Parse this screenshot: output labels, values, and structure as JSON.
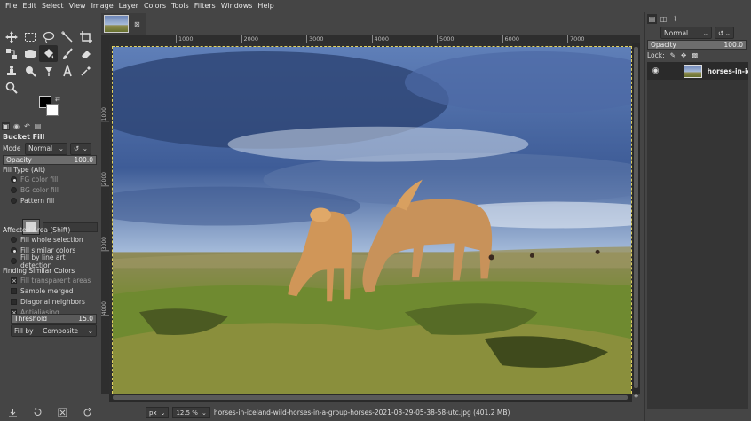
{
  "menu": [
    "File",
    "Edit",
    "Select",
    "View",
    "Image",
    "Layer",
    "Colors",
    "Tools",
    "Filters",
    "Windows",
    "Help"
  ],
  "tool_options": {
    "title": "Bucket Fill",
    "mode_label": "Mode",
    "mode_value": "Normal",
    "opacity_label": "Opacity",
    "opacity_value": "100.0",
    "opacity_fraction": 1.0,
    "fill_type_label": "Fill Type  (Alt)",
    "fill_types": [
      "FG color fill",
      "BG color fill",
      "Pattern fill"
    ],
    "affected_area_label": "Affected Area  (Shift)",
    "affected_areas": [
      "Fill whole selection",
      "Fill similar colors",
      "Fill by line art detection"
    ],
    "finding_label": "Finding Similar Colors",
    "finding_options": [
      "Fill transparent areas",
      "Sample merged",
      "Diagonal neighbors",
      "Antialiasing"
    ],
    "threshold_label": "Threshold",
    "threshold_value": "15.0",
    "threshold_fraction": 0.06,
    "fill_by_label": "Fill by",
    "fill_by_value": "Composite"
  },
  "ruler": {
    "top_labels": [
      "1000",
      "2000",
      "3000",
      "4000",
      "5000",
      "6000",
      "7000"
    ],
    "left_labels": [
      "1000",
      "2000",
      "3000",
      "4000"
    ]
  },
  "statusbar": {
    "unit": "px",
    "zoom": "12.5 %",
    "file_info": "horses-in-iceland-wild-horses-in-a-group-horses-2021-08-29-05-38-58-utc.jpg (401.2 MB)"
  },
  "layers": {
    "mode_value": "Normal",
    "opacity_label": "Opacity",
    "opacity_value": "100.0",
    "lock_label": "Lock:",
    "layer_name": "horses-in-iceland"
  },
  "colors": {
    "panel": "#454545",
    "canvas": "#2f2f2f",
    "selection": "#e0d060"
  }
}
